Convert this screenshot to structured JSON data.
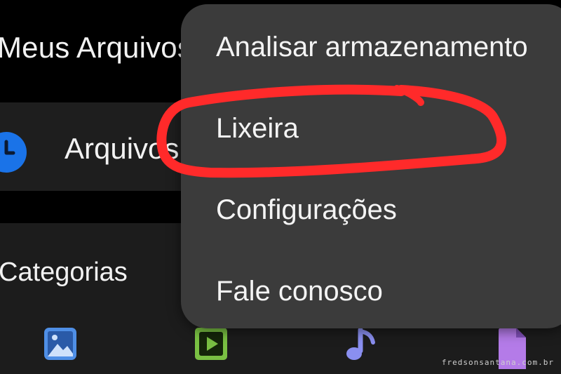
{
  "header": {
    "title": "Meus Arquivos"
  },
  "recent": {
    "label": "Arquivos recentes",
    "icon": "clock-icon",
    "icon_color": "#1a73e8"
  },
  "categories": {
    "title": "Categorias",
    "items": [
      {
        "icon": "image-icon",
        "color": "#4f8fe6"
      },
      {
        "icon": "video-icon",
        "color": "#7ac143"
      },
      {
        "icon": "music-icon",
        "color": "#8a8ff0"
      },
      {
        "icon": "document-icon",
        "color": "#b47be8"
      }
    ]
  },
  "menu": {
    "items": [
      {
        "label": "Analisar armazenamento"
      },
      {
        "label": "Lixeira"
      },
      {
        "label": "Configurações"
      },
      {
        "label": "Fale conosco"
      }
    ],
    "highlight_color": "#ff2a2a"
  },
  "watermark": "fredsonsantana.com.br"
}
